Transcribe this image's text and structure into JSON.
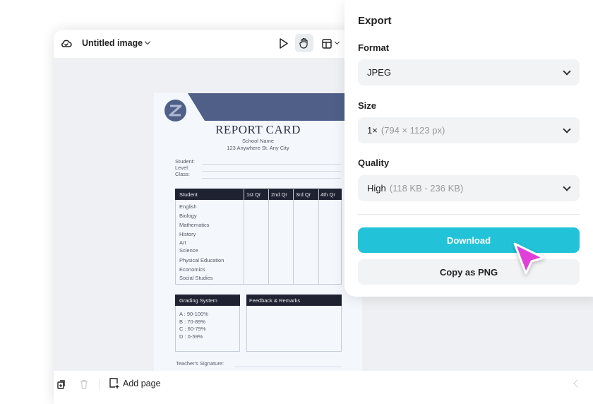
{
  "editor": {
    "title": "Untitled image",
    "add_page": "Add page"
  },
  "document": {
    "title": "REPORT CARD",
    "school": "School Name",
    "address": "123 Anywhere St. Any City",
    "fields": [
      "Student:",
      "Level:",
      "Class:"
    ],
    "table_headers": [
      "Student",
      "1st Qr",
      "2nd Qr",
      "3rd Qr",
      "4th Qr"
    ],
    "subjects": [
      "English",
      "Biology",
      "Mathematics",
      "History",
      "Art",
      "Science",
      "Physical Education",
      "Economics",
      "Social Studies"
    ],
    "grading_title": "Grading System",
    "grades": [
      "A : 90-100%",
      "B : 70-89%",
      "C : 60-79%",
      "D : 0-59%"
    ],
    "feedback_title": "Feedback & Remarks",
    "signature": "Teacher's  Signature:"
  },
  "export": {
    "title": "Export",
    "format_label": "Format",
    "format_value": "JPEG",
    "size_label": "Size",
    "size_value": "1×",
    "size_sub": "(794 × 1123 px)",
    "quality_label": "Quality",
    "quality_value": "High",
    "quality_sub": "(118 KB - 236 KB)",
    "download": "Download",
    "copy": "Copy as PNG"
  },
  "colors": {
    "accent": "#22c3d8",
    "doc_blue": "#4f5f88",
    "doc_dark": "#1f2230",
    "cursor": "#e040d8"
  }
}
